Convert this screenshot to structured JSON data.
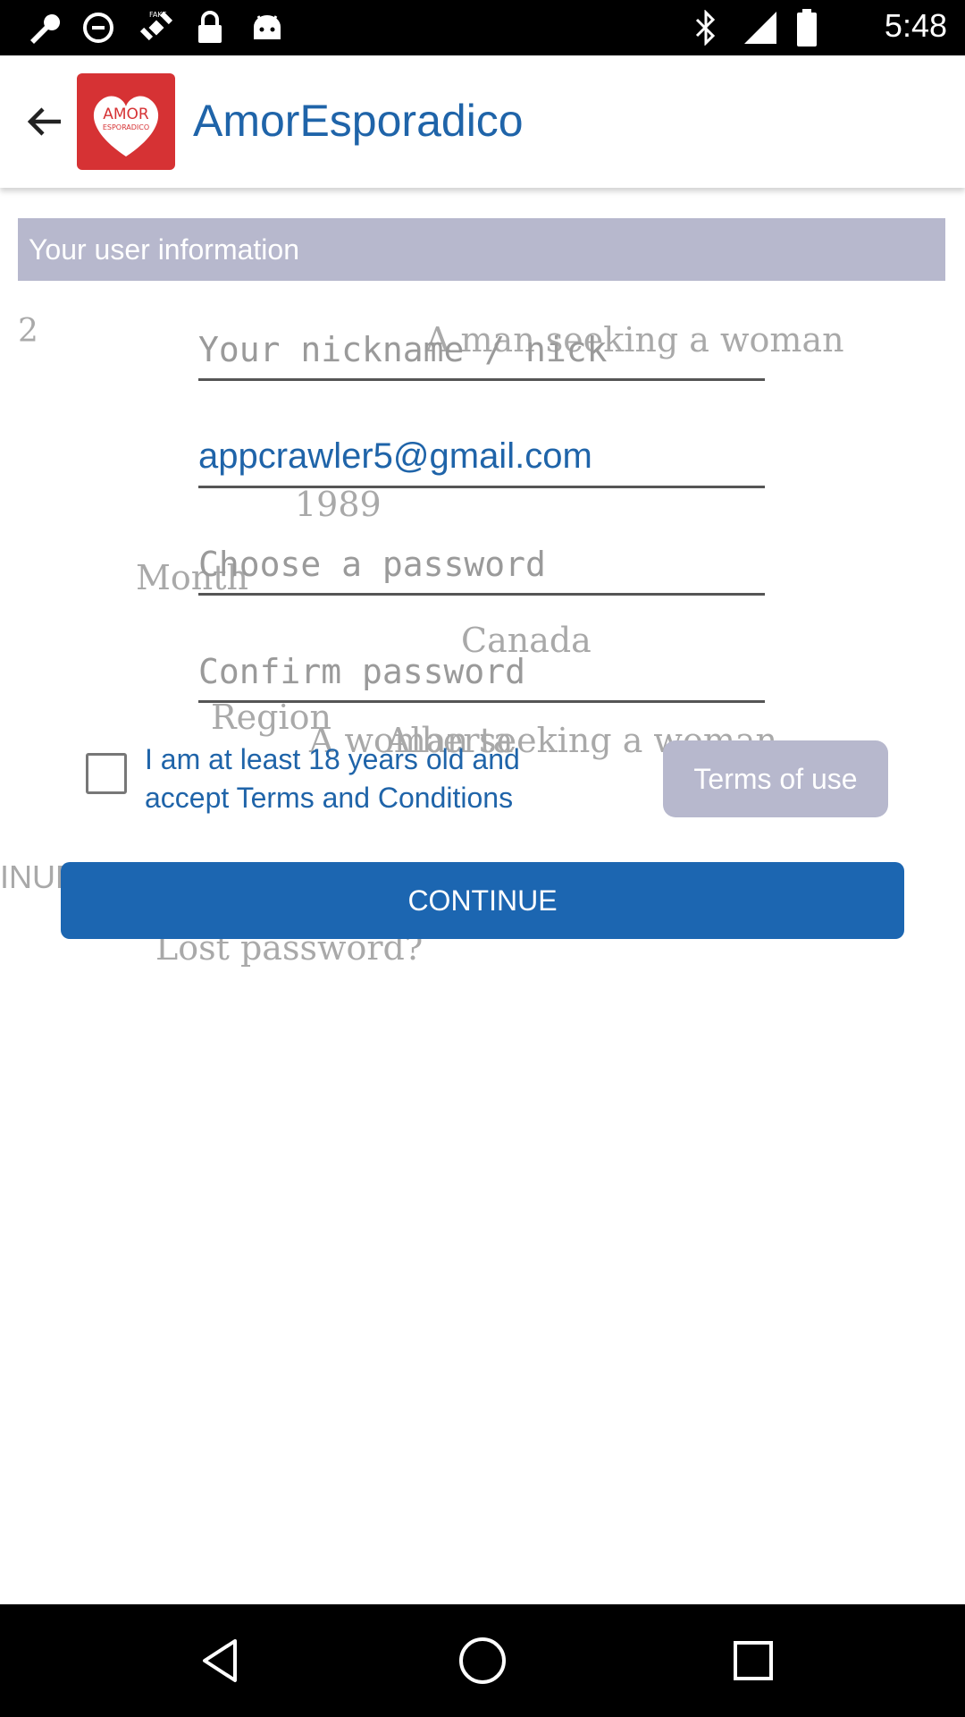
{
  "status_bar": {
    "time": "5:48",
    "icons": [
      "wrench-icon",
      "fake-gps-icon",
      "satellite-icon",
      "lock-icon",
      "android-icon",
      "bluetooth-icon",
      "signal-icon",
      "battery-icon"
    ]
  },
  "app_bar": {
    "title": "AmorEsporadico",
    "logo_text_top": "AMOR",
    "logo_text_bottom": "ESPORADICO"
  },
  "section": {
    "title": "Your user information"
  },
  "ghost_texts": {
    "number": "2",
    "seeking_man": "A man seeking a woman",
    "year": "1989",
    "month": "Month",
    "country": "Canada",
    "region": "Region",
    "alberta": "Alberta",
    "seeking_woman": "A woman seeking a woman",
    "continue_ghost": "INUE",
    "lost_password": "Lost password?"
  },
  "form": {
    "nickname_placeholder": "Your nickname / nick",
    "email_value": "appcrawler5@gmail.com",
    "password_placeholder": "Choose a password",
    "confirm_placeholder": "Confirm password"
  },
  "terms": {
    "checkbox_label_line1": "I am at least 18 years old and",
    "checkbox_label_line2": "accept Terms and Conditions",
    "terms_button": "Terms of use",
    "checked": false
  },
  "continue_button": "CONTINUE",
  "colors": {
    "accent": "#1f64a9",
    "button": "#1c66b1",
    "section_bg": "#b7b8cd",
    "logo_bg": "#d63234"
  }
}
